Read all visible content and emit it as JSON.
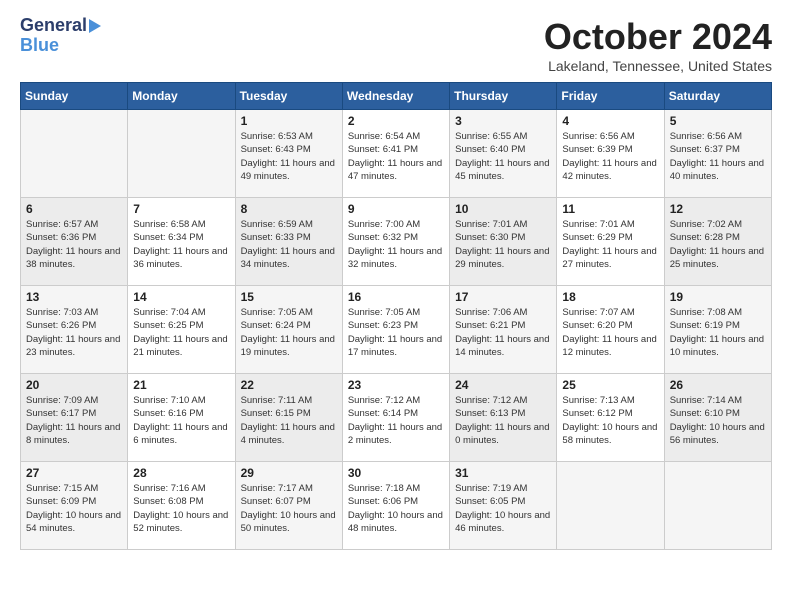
{
  "header": {
    "logo_general": "General",
    "logo_blue": "Blue",
    "month_title": "October 2024",
    "location": "Lakeland, Tennessee, United States"
  },
  "days_of_week": [
    "Sunday",
    "Monday",
    "Tuesday",
    "Wednesday",
    "Thursday",
    "Friday",
    "Saturday"
  ],
  "weeks": [
    [
      {
        "day": "",
        "info": ""
      },
      {
        "day": "",
        "info": ""
      },
      {
        "day": "1",
        "sunrise": "6:53 AM",
        "sunset": "6:43 PM",
        "daylight": "11 hours and 49 minutes."
      },
      {
        "day": "2",
        "sunrise": "6:54 AM",
        "sunset": "6:41 PM",
        "daylight": "11 hours and 47 minutes."
      },
      {
        "day": "3",
        "sunrise": "6:55 AM",
        "sunset": "6:40 PM",
        "daylight": "11 hours and 45 minutes."
      },
      {
        "day": "4",
        "sunrise": "6:56 AM",
        "sunset": "6:39 PM",
        "daylight": "11 hours and 42 minutes."
      },
      {
        "day": "5",
        "sunrise": "6:56 AM",
        "sunset": "6:37 PM",
        "daylight": "11 hours and 40 minutes."
      }
    ],
    [
      {
        "day": "6",
        "sunrise": "6:57 AM",
        "sunset": "6:36 PM",
        "daylight": "11 hours and 38 minutes."
      },
      {
        "day": "7",
        "sunrise": "6:58 AM",
        "sunset": "6:34 PM",
        "daylight": "11 hours and 36 minutes."
      },
      {
        "day": "8",
        "sunrise": "6:59 AM",
        "sunset": "6:33 PM",
        "daylight": "11 hours and 34 minutes."
      },
      {
        "day": "9",
        "sunrise": "7:00 AM",
        "sunset": "6:32 PM",
        "daylight": "11 hours and 32 minutes."
      },
      {
        "day": "10",
        "sunrise": "7:01 AM",
        "sunset": "6:30 PM",
        "daylight": "11 hours and 29 minutes."
      },
      {
        "day": "11",
        "sunrise": "7:01 AM",
        "sunset": "6:29 PM",
        "daylight": "11 hours and 27 minutes."
      },
      {
        "day": "12",
        "sunrise": "7:02 AM",
        "sunset": "6:28 PM",
        "daylight": "11 hours and 25 minutes."
      }
    ],
    [
      {
        "day": "13",
        "sunrise": "7:03 AM",
        "sunset": "6:26 PM",
        "daylight": "11 hours and 23 minutes."
      },
      {
        "day": "14",
        "sunrise": "7:04 AM",
        "sunset": "6:25 PM",
        "daylight": "11 hours and 21 minutes."
      },
      {
        "day": "15",
        "sunrise": "7:05 AM",
        "sunset": "6:24 PM",
        "daylight": "11 hours and 19 minutes."
      },
      {
        "day": "16",
        "sunrise": "7:05 AM",
        "sunset": "6:23 PM",
        "daylight": "11 hours and 17 minutes."
      },
      {
        "day": "17",
        "sunrise": "7:06 AM",
        "sunset": "6:21 PM",
        "daylight": "11 hours and 14 minutes."
      },
      {
        "day": "18",
        "sunrise": "7:07 AM",
        "sunset": "6:20 PM",
        "daylight": "11 hours and 12 minutes."
      },
      {
        "day": "19",
        "sunrise": "7:08 AM",
        "sunset": "6:19 PM",
        "daylight": "11 hours and 10 minutes."
      }
    ],
    [
      {
        "day": "20",
        "sunrise": "7:09 AM",
        "sunset": "6:17 PM",
        "daylight": "11 hours and 8 minutes."
      },
      {
        "day": "21",
        "sunrise": "7:10 AM",
        "sunset": "6:16 PM",
        "daylight": "11 hours and 6 minutes."
      },
      {
        "day": "22",
        "sunrise": "7:11 AM",
        "sunset": "6:15 PM",
        "daylight": "11 hours and 4 minutes."
      },
      {
        "day": "23",
        "sunrise": "7:12 AM",
        "sunset": "6:14 PM",
        "daylight": "11 hours and 2 minutes."
      },
      {
        "day": "24",
        "sunrise": "7:12 AM",
        "sunset": "6:13 PM",
        "daylight": "11 hours and 0 minutes."
      },
      {
        "day": "25",
        "sunrise": "7:13 AM",
        "sunset": "6:12 PM",
        "daylight": "10 hours and 58 minutes."
      },
      {
        "day": "26",
        "sunrise": "7:14 AM",
        "sunset": "6:10 PM",
        "daylight": "10 hours and 56 minutes."
      }
    ],
    [
      {
        "day": "27",
        "sunrise": "7:15 AM",
        "sunset": "6:09 PM",
        "daylight": "10 hours and 54 minutes."
      },
      {
        "day": "28",
        "sunrise": "7:16 AM",
        "sunset": "6:08 PM",
        "daylight": "10 hours and 52 minutes."
      },
      {
        "day": "29",
        "sunrise": "7:17 AM",
        "sunset": "6:07 PM",
        "daylight": "10 hours and 50 minutes."
      },
      {
        "day": "30",
        "sunrise": "7:18 AM",
        "sunset": "6:06 PM",
        "daylight": "10 hours and 48 minutes."
      },
      {
        "day": "31",
        "sunrise": "7:19 AM",
        "sunset": "6:05 PM",
        "daylight": "10 hours and 46 minutes."
      },
      {
        "day": "",
        "info": ""
      },
      {
        "day": "",
        "info": ""
      }
    ]
  ]
}
